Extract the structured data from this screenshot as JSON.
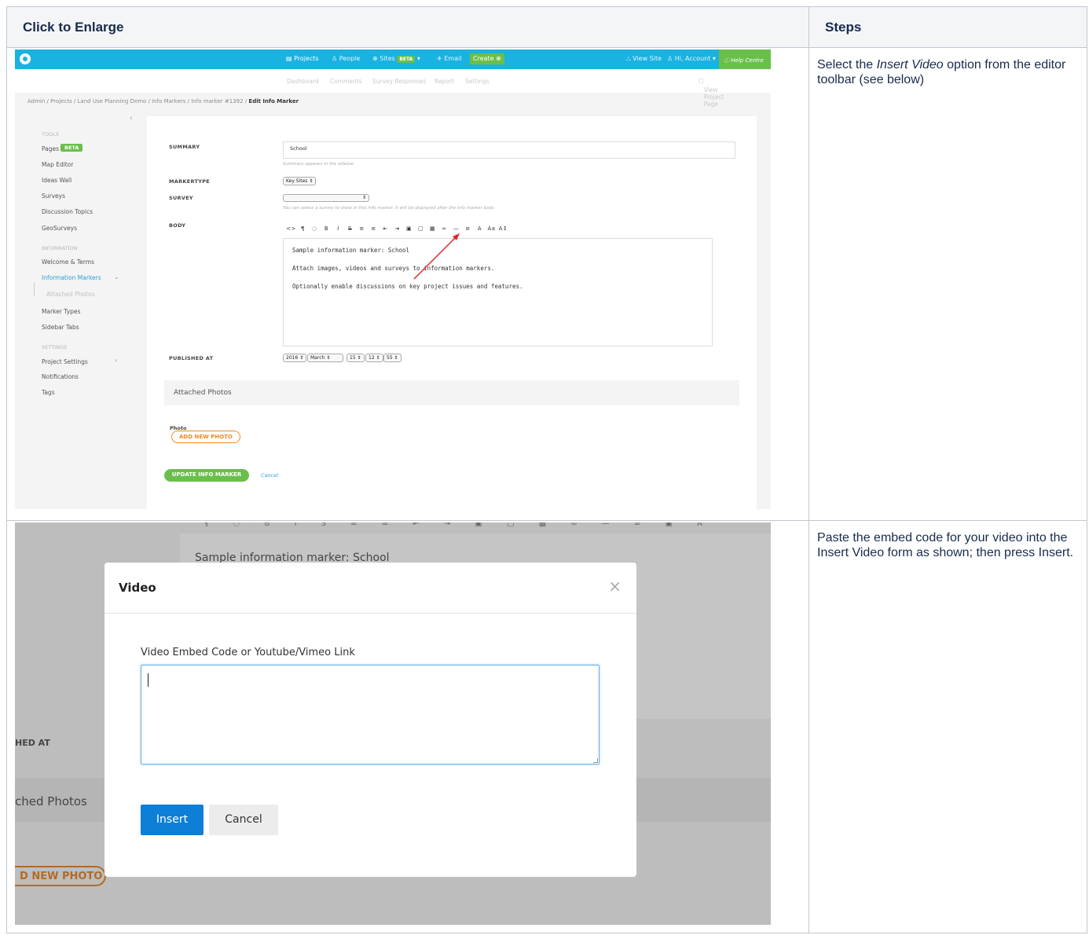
{
  "table": {
    "headers": [
      "Click to Enlarge",
      "Steps"
    ],
    "rows": [
      {
        "step_parts": [
          "Select the ",
          "Insert Video",
          " option from the editor toolbar (see below)"
        ]
      },
      {
        "step": "Paste the embed code for your video into the Insert Video form as shown; then press Insert."
      }
    ]
  },
  "shot1": {
    "topnav": {
      "projects": "Projects",
      "people": "People",
      "sites": "Sites",
      "beta": "BETA",
      "email": "Email",
      "create": "Create",
      "view_site": "View Site",
      "account": "Hi, Account",
      "help": "Help Centre"
    },
    "subnav": [
      "Dashboard",
      "Comments",
      "Survey Responses",
      "Report",
      "Settings"
    ],
    "view_project": "View Project Page",
    "breadcrumb": "Admin / Projects / Land Use Planning Demo / Info Markers / Info marker #1392 /",
    "breadcrumb_current": "Edit Info Marker",
    "sidebar": {
      "tools_head": "TOOLS",
      "pages": "Pages",
      "pages_badge": "BETA",
      "map_editor": "Map Editor",
      "ideas_wall": "Ideas Wall",
      "surveys": "Surveys",
      "discussion": "Discussion Topics",
      "geosurveys": "GeoSurveys",
      "info_head": "INFORMATION",
      "welcome": "Welcome & Terms",
      "info_markers": "Information Markers",
      "attached": "Attached Photos",
      "marker_types": "Marker Types",
      "sidebar_tabs": "Sidebar Tabs",
      "settings_head": "SETTINGS",
      "project_settings": "Project Settings",
      "notifications": "Notifications",
      "tags": "Tags"
    },
    "form": {
      "summary_label": "SUMMARY",
      "summary_value": "School",
      "summary_hint": "Summary appears in the sidebar",
      "markertype_label": "MARKERTYPE",
      "markertype_value": "Key Sites",
      "survey_label": "SURVEY",
      "survey_hint": "You can select a survey to show in this info marker. It will be displayed after the info marker body",
      "body_label": "BODY",
      "toolbar": "<> ¶ ◌ B I S ≡ ≡ ≡ ≡ ▣ ▢ ▦ ∞ — ≡ A Aa A↕",
      "body_lines": [
        "Sample information marker: School",
        "Attach images, videos and surveys to information markers.",
        "Optionally enable discussions on key project issues and features."
      ],
      "published_label": "PUBLISHED AT",
      "published": {
        "year": "2016",
        "month": "March",
        "day": "15",
        "hour": "12",
        "minute": "55"
      },
      "photos_header": "Attached Photos",
      "photo_label": "Photo",
      "add_photo": "ADD NEW PHOTO",
      "update": "UPDATE INFO MARKER",
      "cancel": "Cancel"
    },
    "arrow_color": "#e0262a"
  },
  "shot2": {
    "bg_body": "Sample information marker: School",
    "bg_published": "HED AT",
    "bg_photos": "ched Photos",
    "bg_add_photo": "D NEW PHOTO",
    "modal": {
      "title": "Video",
      "close": "×",
      "label": "Video Embed Code or Youtube/Vimeo Link",
      "input_value": "",
      "insert": "Insert",
      "cancel": "Cancel"
    },
    "accent": "#0d7fd6"
  }
}
